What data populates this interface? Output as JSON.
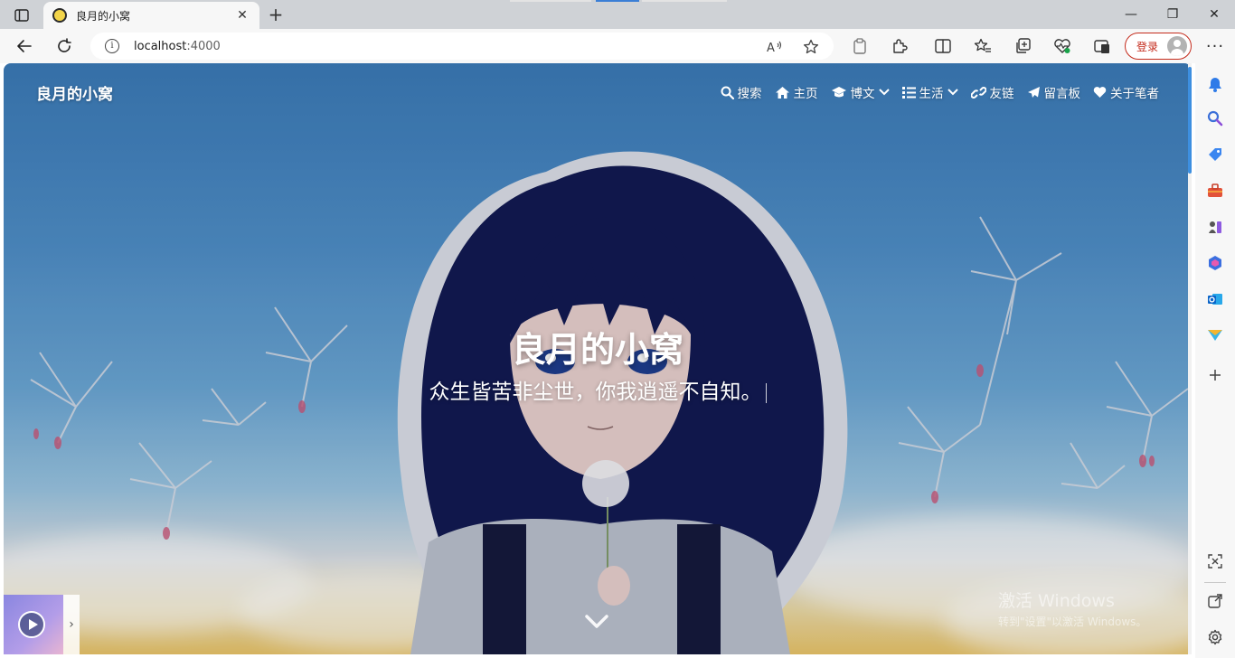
{
  "browser": {
    "tab": {
      "title": "良月的小窝",
      "close_glyph": "✕"
    },
    "new_tab_glyph": "+",
    "window": {
      "minimize": "—",
      "maximize": "❐",
      "close": "✕"
    },
    "address": {
      "host": "localhost",
      "port": ":4000"
    },
    "login_label": "登录",
    "more_glyph": "···",
    "accent": "#c42b1c"
  },
  "site": {
    "brand": "良月的小窝",
    "nav": [
      {
        "label": "搜索",
        "icon": "search-icon"
      },
      {
        "label": "主页",
        "icon": "home-icon"
      },
      {
        "label": "博文",
        "icon": "graduation-cap-icon",
        "dropdown": true
      },
      {
        "label": "生活",
        "icon": "list-icon",
        "dropdown": true
      },
      {
        "label": "友链",
        "icon": "link-icon"
      },
      {
        "label": "留言板",
        "icon": "paper-plane-icon"
      },
      {
        "label": "关于笔者",
        "icon": "heart-icon"
      }
    ],
    "hero_title": "良月的小窝",
    "hero_subtitle": "众生皆苦非尘世，你我逍遥不自知。",
    "player_toggle": "›"
  },
  "watermark": {
    "line1": "激活 Windows",
    "line2": "转到\"设置\"以激活 Windows。"
  },
  "sidebar_icons": [
    "bell-icon",
    "search-icon",
    "tag-icon",
    "toolbox-icon",
    "chess-icon",
    "copilot-icon",
    "outlook-icon",
    "send-icon",
    "add-icon",
    "screenshot-icon",
    "open-external-icon",
    "settings-icon"
  ]
}
